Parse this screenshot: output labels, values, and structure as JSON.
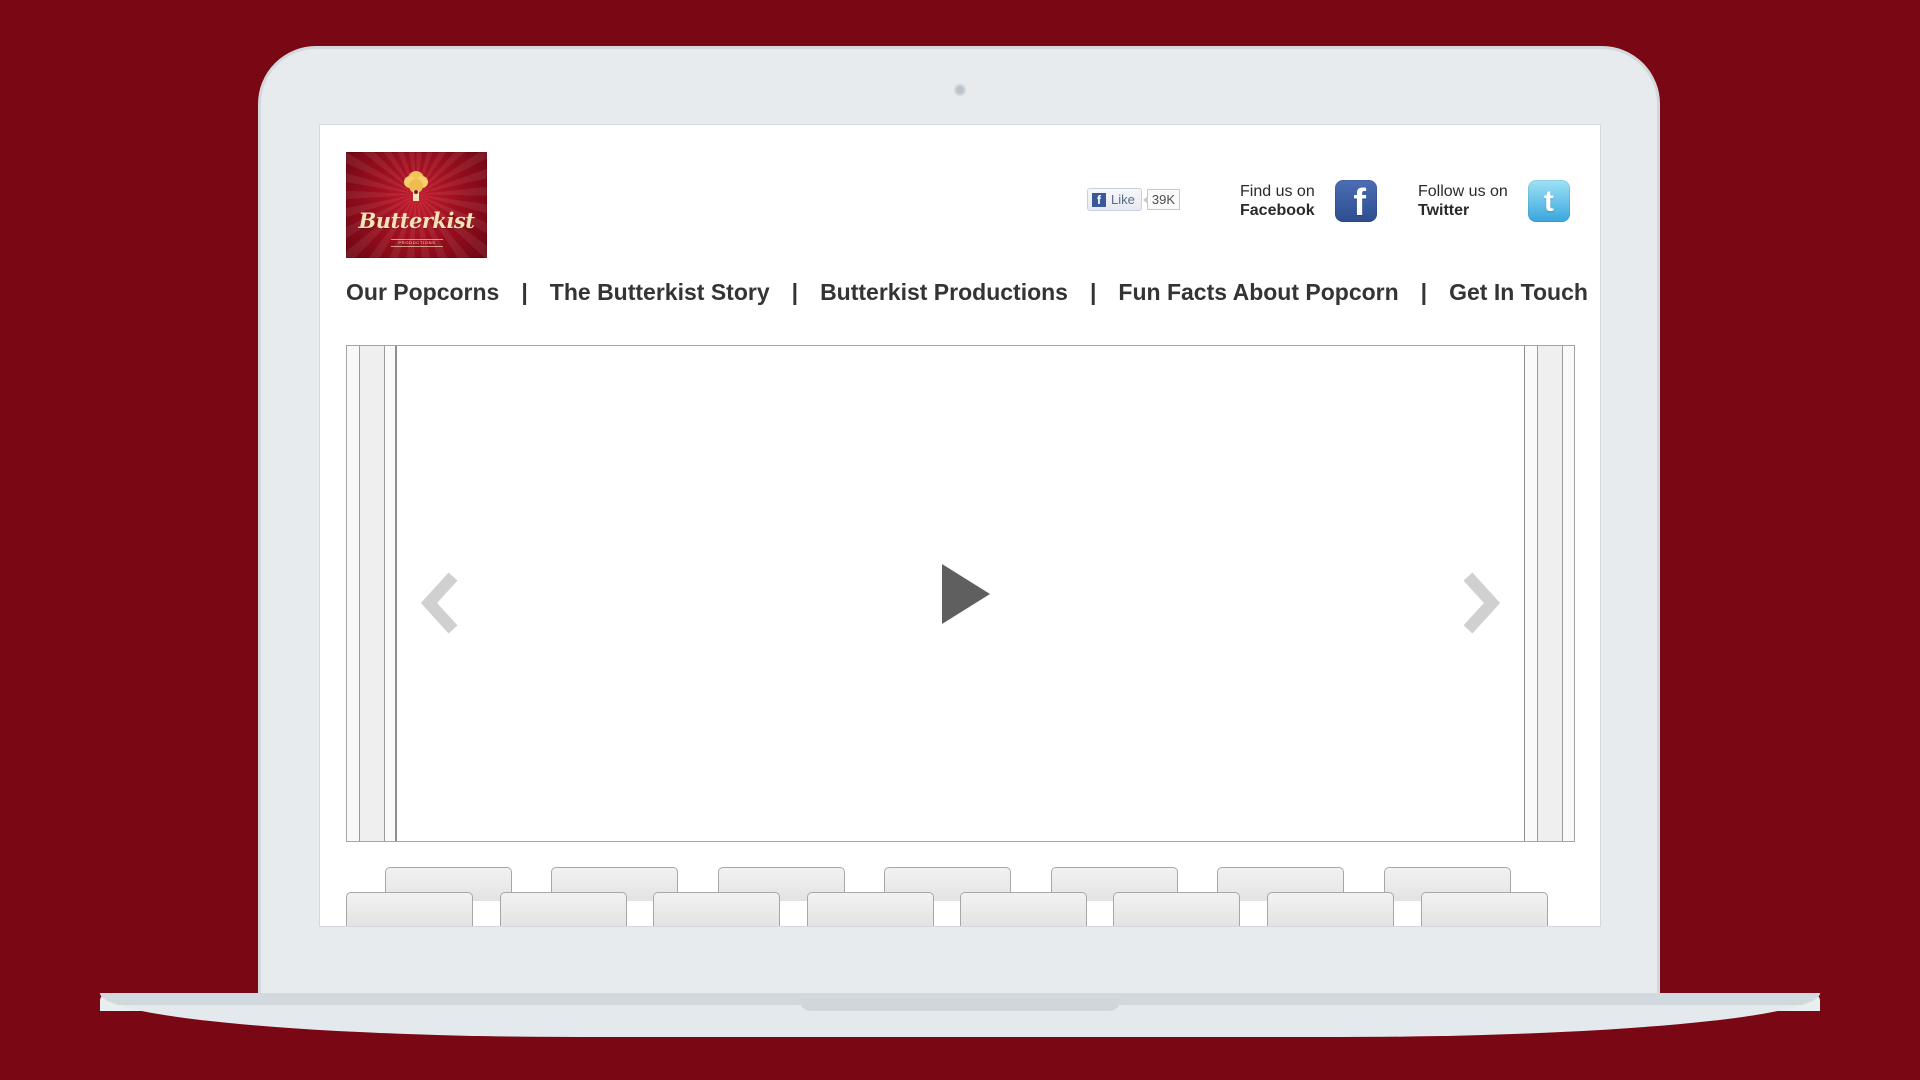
{
  "brand": {
    "logo_text": "Butterkist",
    "logo_subtext": "PRODUCTIONS"
  },
  "social": {
    "like": {
      "label": "Like",
      "count": "39K"
    },
    "facebook": {
      "line1": "Find us on",
      "line2": "Facebook",
      "icon": "facebook-icon"
    },
    "twitter": {
      "line1": "Follow us on",
      "line2": "Twitter",
      "icon": "twitter-icon"
    }
  },
  "nav": {
    "items": [
      "Our Popcorns",
      "The Butterkist Story",
      "Butterkist Productions",
      "Fun Facts About Popcorn",
      "Get In Touch"
    ],
    "separator": "|"
  },
  "hero": {
    "play_icon": "play-icon",
    "previous_icon": "chevron-left-icon",
    "next_icon": "chevron-right-icon"
  },
  "colors": {
    "background": "#7a0714",
    "screen": "#ffffff",
    "text": "#343434",
    "facebook": "#3b5998",
    "twitter": "#38a6dc",
    "control_gray": "#d0d0d0",
    "play_gray": "#5f5f5f"
  }
}
